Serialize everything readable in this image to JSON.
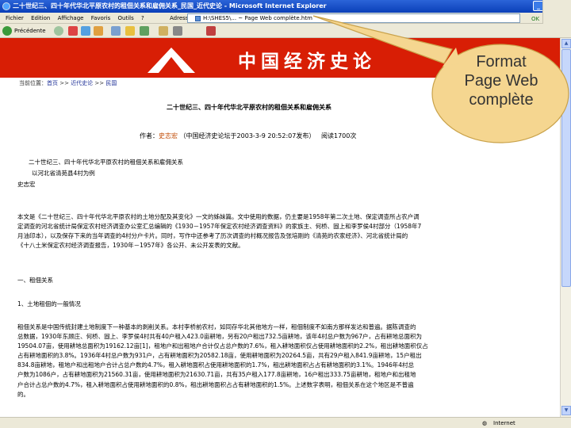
{
  "window": {
    "title": "二十世纪三、四十年代华北平原农村的租佃关系和雇佣关系_民国_近代史论 - Microsoft Internet Explorer",
    "controls": {
      "minimize": "_",
      "maximize": "□",
      "close": "×"
    }
  },
  "menubar": {
    "items": [
      "Fichier",
      "Edition",
      "Affichage",
      "Favoris",
      "Outils",
      "?"
    ],
    "address_label": "Adresse",
    "address_value": "H:\\SHES5\\... ~ Page Web complète.htm",
    "go_label": "OK"
  },
  "toolbar": {
    "back_label": "Précédente",
    "icons": [
      "back-icon",
      "forward-icon",
      "stop-icon",
      "refresh-icon",
      "home-icon",
      "search-icon",
      "favorites-icon",
      "history-icon",
      "mail-icon",
      "print-icon",
      "edit-icon"
    ]
  },
  "page": {
    "banner_title": "中国经济史论",
    "breadcrumb": {
      "prefix": "当前位置：",
      "home": "首页",
      "sep1": " >> ",
      "section": "近代史论",
      "sep2": " >> ",
      "current": "民国"
    },
    "doc_title": "二十世纪三、四十年代华北平原农村的租佃关系和雇佣关系",
    "meta": {
      "author_prefix": "作者：",
      "author": "史志宏",
      "source": "（中国经济史论坛于2003-3-9 20:52:07发布）",
      "reads": "阅读1700次"
    },
    "subtitle": "二十世纪三、四十年代华北平原农村的租佃关系和雇佣关系",
    "subtitle2": "以河北省清苑县4村为例",
    "author_line": "史志宏",
    "intro": [
      "本文是《二十世纪三、四十年代华北平原农村的土地分配及其变化》一文的姊妹篇。文中使用的数据，仍主要是1958年第二次土地、保定调查所占农户调",
      "定调查的河北省统计局保定农村经济调查办公室汇总编辑的《1930－1957年保定农村经济调查资料》的家族主、何桥、固上和李罗侯4村部分（1958年7",
      "月油印本），以及保存下来的当年调查的4村分户卡片。同时，写作中还参考了历次调查的村概况报告及张培刚的《清苑的农家经济》、河北省统计局的",
      "《十八土米保定农村经济调查报告，1930年－1957年》各公开、未公开发表的文献。"
    ],
    "heading1": "一、租佃关系",
    "heading2": "1、土地租佃的一般情况",
    "body": [
      "租佃关系是中国传统封建土地制度下一种基本的剥削关系。本村李桥前农村，如同存华北其他地方一样，租佃制度不如南方那样发达和普遍。据陈调查的",
      "总数据，1930年东顾庄、何桥、固上、李罗侯4村共有40户租入423.0亩耕地，另有20户租出732.5亩耕地，该年4村总户数为967户，占有耕地总面积为",
      "19504.07亩，使用耕地总面积为19162.12亩[1]，租地户和出租地户合计仅占总户数的7.6%，租入耕地面积仅占使用耕地面积的2.2%，租出耕地面积仅占",
      "占有耕地面积的3.8%。1936年4村总户数为931户，占有耕地面积为20582.18亩，使用耕地面积为20264.5亩，共有29户租入841.9亩耕地，15户租出",
      "834.8亩耕地，租地户和出租地户合计占总户数的4.7%，租入耕地面积占使用耕地面积的1.7%，租出耕地面积占占有耕地面积的3.1%。1946年4村总",
      "户数为1086户，占有耕地面积为21560.31亩，使用耕地面积为21630.71亩，共有35户租入177.8亩耕地，16户租出333.75亩耕地，租地户和出租地",
      "户合计占总户数的4.7%，租入耕地面积占使用耕地面积的0.8%，租出耕地面积占占有耕地面积的1.5%。上述数字表明，租佃关系在这个地区是不普遍",
      "的。"
    ]
  },
  "statusbar": {
    "zone": "Internet"
  },
  "callout": {
    "text_lines": [
      "Format",
      "Page Web",
      "complète"
    ],
    "fill": "#f5d690",
    "stroke": "#c9a24a"
  }
}
